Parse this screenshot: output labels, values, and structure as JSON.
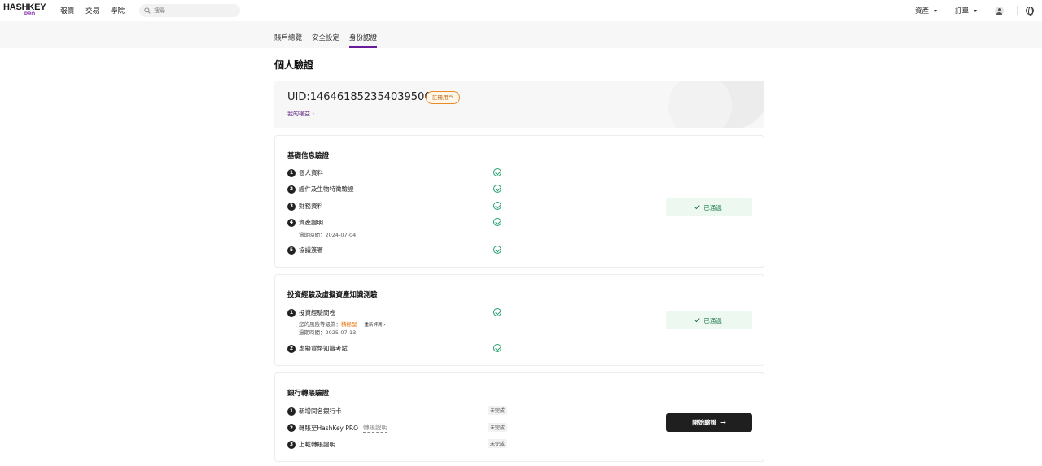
{
  "header": {
    "logo_main": "HASHKEY",
    "logo_sub": "PRO",
    "nav": [
      "報價",
      "交易",
      "學院"
    ],
    "search_placeholder": "搜尋",
    "right_nav": {
      "assets": "資產",
      "orders": "訂單"
    }
  },
  "tabs": [
    {
      "label": "賬戶總覽",
      "active": false
    },
    {
      "label": "安全設定",
      "active": false
    },
    {
      "label": "身份認證",
      "active": true
    }
  ],
  "page_title": "個人驗證",
  "uid_card": {
    "uid": "UID:1464618523540395008",
    "badge": "註冊用戶",
    "rights_link": "我的權益"
  },
  "basic": {
    "title": "基礎信息驗證",
    "steps": [
      {
        "num": "1",
        "label": "個人資料"
      },
      {
        "num": "2",
        "label": "證件及生物特徵驗證"
      },
      {
        "num": "3",
        "label": "財務資料"
      },
      {
        "num": "4",
        "label": "資產證明",
        "note": "過期時間：2024-07-04"
      },
      {
        "num": "5",
        "label": "協議簽署"
      }
    ],
    "status": "已通過"
  },
  "investment": {
    "title": "投資經驗及虛擬資產知識測驗",
    "steps": [
      {
        "num": "1",
        "label": "投資經驗問卷",
        "risk_prefix": "您的風險等級為：",
        "risk_level": "積極型",
        "retest": "重新評測",
        "expiry": "過期時間：2025-07-13"
      },
      {
        "num": "2",
        "label": "虛擬貨幣知識考試"
      }
    ],
    "status": "已通過"
  },
  "bank": {
    "title": "銀行轉賬驗證",
    "steps": [
      {
        "num": "1",
        "label": "新增同名銀行卡",
        "status": "未完成"
      },
      {
        "num": "2",
        "label": "轉賬至HashKey PRO",
        "link": "轉賬說明",
        "status": "未完成"
      },
      {
        "num": "3",
        "label": "上載轉賬證明",
        "status": "未完成"
      }
    ],
    "button": "開始驗證"
  },
  "colors": {
    "accent": "#6a1b9a",
    "success": "#22a06b",
    "warning": "#e8770e",
    "dark_button": "#1f1f1f"
  }
}
